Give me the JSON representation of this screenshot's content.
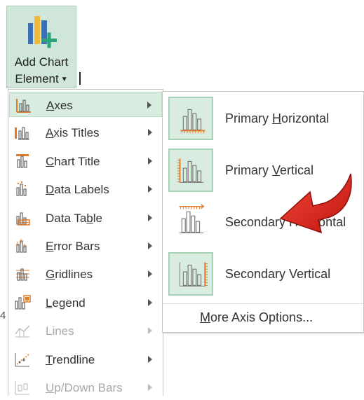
{
  "ribbon": {
    "button_line1": "Add Chart",
    "button_line2": "Element",
    "icon": "add-chart-element-icon"
  },
  "menu": {
    "items": [
      {
        "label": "Axes",
        "mnemonic": "A",
        "icon": "axes-icon",
        "active": true,
        "enabled": true
      },
      {
        "label": "Axis Titles",
        "mnemonic": "A",
        "icon": "axis-titles-icon",
        "active": false,
        "enabled": true
      },
      {
        "label": "Chart Title",
        "mnemonic": "C",
        "icon": "chart-title-icon",
        "active": false,
        "enabled": true
      },
      {
        "label": "Data Labels",
        "mnemonic": "D",
        "icon": "data-labels-icon",
        "active": false,
        "enabled": true
      },
      {
        "label": "Data Table",
        "mnemonic": "b",
        "icon": "data-table-icon",
        "active": false,
        "enabled": true
      },
      {
        "label": "Error Bars",
        "mnemonic": "E",
        "icon": "error-bars-icon",
        "active": false,
        "enabled": true
      },
      {
        "label": "Gridlines",
        "mnemonic": "G",
        "icon": "gridlines-icon",
        "active": false,
        "enabled": true
      },
      {
        "label": "Legend",
        "mnemonic": "L",
        "icon": "legend-icon",
        "active": false,
        "enabled": true
      },
      {
        "label": "Lines",
        "mnemonic": "I",
        "icon": "lines-icon",
        "active": false,
        "enabled": false
      },
      {
        "label": "Trendline",
        "mnemonic": "T",
        "icon": "trendline-icon",
        "active": false,
        "enabled": true
      },
      {
        "label": "Up/Down Bars",
        "mnemonic": "U",
        "icon": "up-down-bars-icon",
        "active": false,
        "enabled": false
      }
    ]
  },
  "submenu": {
    "items": [
      {
        "label": "Primary Horizontal",
        "mnemonic": "H",
        "icon": "primary-horizontal-axis-icon",
        "selected": true
      },
      {
        "label": "Primary Vertical",
        "mnemonic": "V",
        "icon": "primary-vertical-axis-icon",
        "selected": true
      },
      {
        "label": "Secondary Horizontal",
        "mnemonic": "",
        "icon": "secondary-horizontal-axis-icon",
        "selected": false
      },
      {
        "label": "Secondary Vertical",
        "mnemonic": "E",
        "icon": "secondary-vertical-axis-icon",
        "selected": true
      }
    ],
    "more_options": "More Axis Options...",
    "more_mnemonic": "M"
  },
  "stray_text": "4",
  "colors": {
    "selection_bg": "#d8ecdf",
    "ribbon_bg": "#cfe6d8",
    "accent_orange": "#e07b2a",
    "annotation_red": "#e0201c"
  }
}
